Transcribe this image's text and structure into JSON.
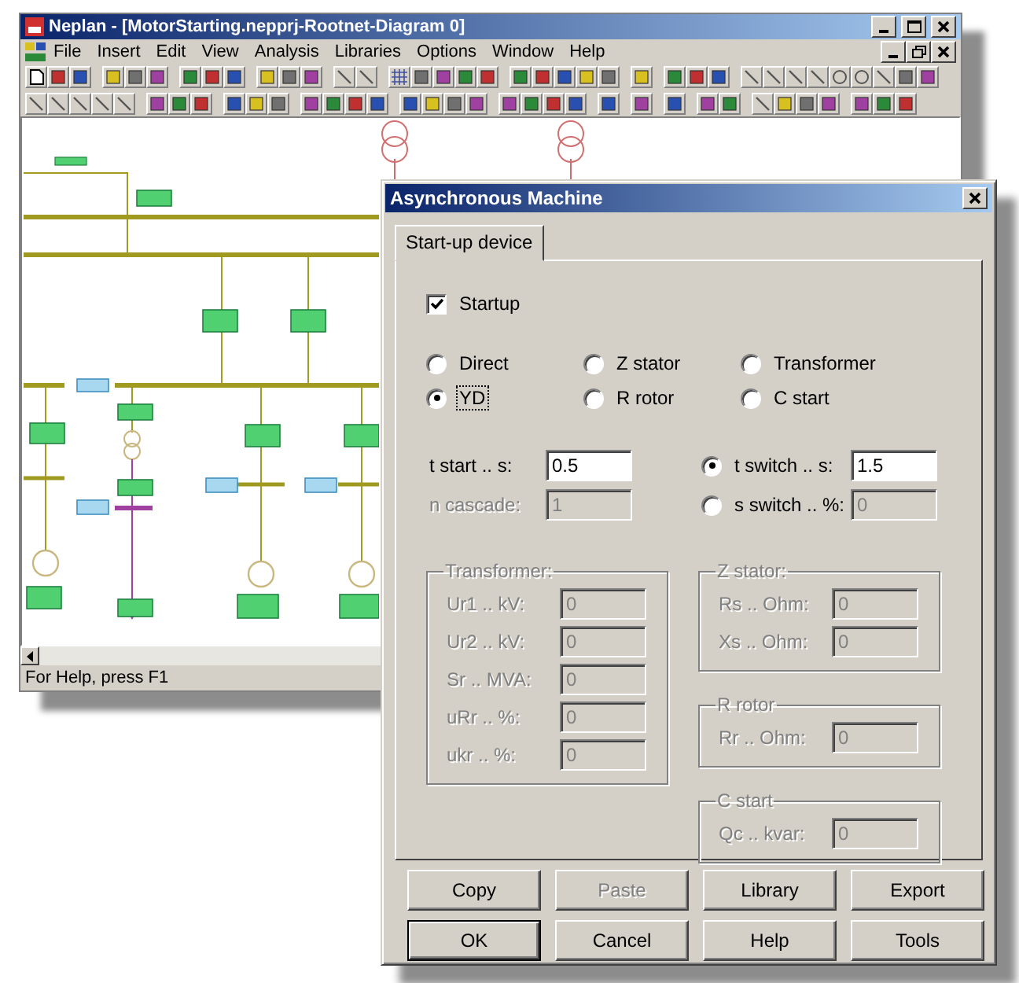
{
  "main_window": {
    "title": "Neplan - [MotorStarting.nepprj-Rootnet-Diagram 0]",
    "menu": [
      "File",
      "Insert",
      "Edit",
      "View",
      "Analysis",
      "Libraries",
      "Options",
      "Window",
      "Help"
    ],
    "status_bar": "For Help, press F1"
  },
  "dialog": {
    "title": "Asynchronous Machine",
    "tabs": [
      {
        "label": "Start-up device",
        "selected": true
      }
    ],
    "startup": {
      "label": "Startup",
      "checked": true
    },
    "methods": [
      {
        "label": "Direct",
        "selected": false,
        "focused": false
      },
      {
        "label": "Z stator",
        "selected": false,
        "focused": false
      },
      {
        "label": "Transformer",
        "selected": false,
        "focused": false
      },
      {
        "label": "YD",
        "selected": true,
        "focused": true
      },
      {
        "label": "R rotor",
        "selected": false,
        "focused": false
      },
      {
        "label": "C start",
        "selected": false,
        "focused": false
      }
    ],
    "left_fields": [
      {
        "label": "t start .. s:",
        "value": "0.5",
        "disabled": false
      },
      {
        "label": "n cascade:",
        "value": "1",
        "disabled": true
      }
    ],
    "switch_modes": [
      {
        "label": "t switch .. s:",
        "selected": true,
        "value": "1.5",
        "disabled": false
      },
      {
        "label": "s switch .. %:",
        "selected": false,
        "value": "0",
        "disabled": true
      }
    ],
    "left_groups": [
      {
        "title": "Transformer:",
        "disabled": true,
        "fields": [
          {
            "label": "Ur1 .. kV:",
            "value": "0"
          },
          {
            "label": "Ur2 .. kV:",
            "value": "0"
          },
          {
            "label": "Sr .. MVA:",
            "value": "0"
          },
          {
            "label": "uRr .. %:",
            "value": "0"
          },
          {
            "label": "ukr .. %:",
            "value": "0"
          }
        ]
      }
    ],
    "right_groups": [
      {
        "title": "Z stator:",
        "disabled": true,
        "fields": [
          {
            "label": "Rs .. Ohm:",
            "value": "0"
          },
          {
            "label": "Xs .. Ohm:",
            "value": "0"
          }
        ]
      },
      {
        "title": "R rotor",
        "disabled": true,
        "fields": [
          {
            "label": "Rr .. Ohm:",
            "value": "0"
          }
        ]
      },
      {
        "title": "C start",
        "disabled": true,
        "fields": [
          {
            "label": "Qc .. kvar:",
            "value": "0"
          }
        ]
      }
    ],
    "buttons": [
      {
        "label": "Copy",
        "disabled": false,
        "default": false
      },
      {
        "label": "Paste",
        "disabled": true,
        "default": false
      },
      {
        "label": "Library",
        "disabled": false,
        "default": false
      },
      {
        "label": "Export",
        "disabled": false,
        "default": false
      },
      {
        "label": "OK",
        "disabled": false,
        "default": true
      },
      {
        "label": "Cancel",
        "disabled": false,
        "default": false
      },
      {
        "label": "Help",
        "disabled": false,
        "default": false
      },
      {
        "label": "Tools",
        "disabled": false,
        "default": false
      }
    ]
  }
}
